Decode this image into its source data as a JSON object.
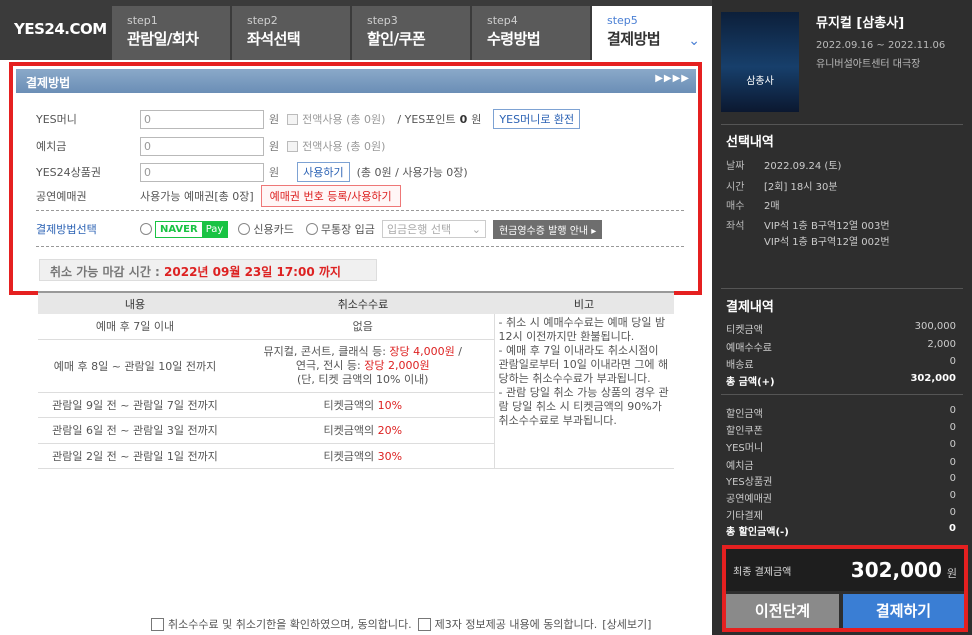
{
  "logo": "YES24.COM",
  "steps": [
    {
      "num": "step1",
      "label": "관람일/회차"
    },
    {
      "num": "step2",
      "label": "좌석선택"
    },
    {
      "num": "step3",
      "label": "할인/쿠폰"
    },
    {
      "num": "step4",
      "label": "수령방법"
    },
    {
      "num": "step5",
      "label": "결제방법"
    }
  ],
  "payment": {
    "title": "결제방법",
    "arrows": "▶▶▶▶",
    "yesmoney": {
      "label": "YES머니",
      "value": "0",
      "unit": "원",
      "full_use": "전액사용 (총 0원)",
      "point_label": "/ YES포인트",
      "point_value": "0",
      "point_unit": "원",
      "convert_btn": "YES머니로 환전"
    },
    "deposit": {
      "label": "예치금",
      "value": "0",
      "unit": "원",
      "full_use": "전액사용 (총 0원)"
    },
    "giftcard": {
      "label": "YES24상품권",
      "value": "0",
      "unit": "원",
      "use_btn": "사용하기",
      "note": "(총 0원 / 사용가능 0장)"
    },
    "voucher": {
      "label": "공연예매권",
      "available": "사용가능 예매권[총 0장]",
      "register_btn": "예매권 번호 등록/사용하기"
    },
    "method": {
      "label": "결제방법선택",
      "naver_n": "NAVER",
      "naver_pay": "Pay",
      "card": "신용카드",
      "bank": "무통장 입금",
      "bank_select": "입금은행 선택",
      "receipt_btn": "현금영수증 발행 안내 ▸"
    },
    "deadline_label": "취소 가능 마감 시간 :",
    "deadline_value": "2022년 09월 23일 17:00 까지"
  },
  "fee_table": {
    "headers": [
      "내용",
      "취소수수료",
      "비고"
    ],
    "rows": [
      {
        "period": "예매 후 7일 이내",
        "fee": "없음"
      },
      {
        "period": "예매 후 8일 ~ 관람일 10일 전까지",
        "fee_l1": "뮤지컬, 콘서트, 클래식 등:",
        "fee_l1r": "장당 4,000원",
        "fee_l1e": "/",
        "fee_l2": "연극, 전시 등:",
        "fee_l2r": "장당 2,000원",
        "fee_l3": "(단, 티켓 금액의 10% 이내)"
      },
      {
        "period": "관람일 9일 전 ~ 관람일 7일 전까지",
        "fee": "티켓금액의",
        "pct": "10%"
      },
      {
        "period": "관람일 6일 전 ~ 관람일 3일 전까지",
        "fee": "티켓금액의",
        "pct": "20%"
      },
      {
        "period": "관람일 2일 전 ~ 관람일 1일 전까지",
        "fee": "티켓금액의",
        "pct": "30%"
      }
    ],
    "notes": "- 취소 시 예매수수료는 예매 당일 밤 12시 이전까지만 환불됩니다.\n- 예매 후 7일 이내라도 취소시점이 관람일로부터 10일 이내라면 그에 해당하는 취소수수료가 부과됩니다.\n- 관람 당일 취소 가능 상품의 경우 관람 당일 취소 시 티켓금액의 90%가 취소수수료로 부과됩니다."
  },
  "agree": {
    "cancel": "취소수수료 및 취소기한을 확인하였으며, 동의합니다.",
    "thirdparty": "제3자 정보제공 내용에 동의합니다.",
    "detail": "[상세보기]"
  },
  "show": {
    "poster_text": "삼총사",
    "title": "뮤지컬 [삼총사]",
    "date": "2022.09.16 ~ 2022.11.06",
    "venue": "유니버설아트센터 대극장"
  },
  "selection": {
    "title": "선택내역",
    "items": [
      {
        "k": "날짜",
        "v": "2022.09.24 (토)"
      },
      {
        "k": "시간",
        "v": "[2회] 18시 30분"
      },
      {
        "k": "매수",
        "v": "2매"
      },
      {
        "k": "좌석",
        "v": "VIP석 1층 B구역12열 003번"
      }
    ],
    "seat2": "VIP석 1층 B구역12열 002번"
  },
  "payinfo": {
    "title": "결제내역",
    "items": [
      {
        "k": "티켓금액",
        "v": "300,000"
      },
      {
        "k": "예매수수료",
        "v": "2,000"
      },
      {
        "k": "배송료",
        "v": "0"
      },
      {
        "k": "총 금액(+)",
        "v": "302,000"
      }
    ],
    "discounts": [
      {
        "k": "할인금액",
        "v": "0"
      },
      {
        "k": "할인쿠폰",
        "v": "0"
      },
      {
        "k": "YES머니",
        "v": "0"
      },
      {
        "k": "예치금",
        "v": "0"
      },
      {
        "k": "YES상품권",
        "v": "0"
      },
      {
        "k": "공연예매권",
        "v": "0"
      },
      {
        "k": "기타결제",
        "v": "0"
      },
      {
        "k": "총 할인금액(-)",
        "v": "0"
      }
    ],
    "final_label": "최종 결제금액",
    "final_value": "302,000",
    "final_unit": "원"
  },
  "buttons": {
    "prev": "이전단계",
    "pay": "결제하기"
  }
}
